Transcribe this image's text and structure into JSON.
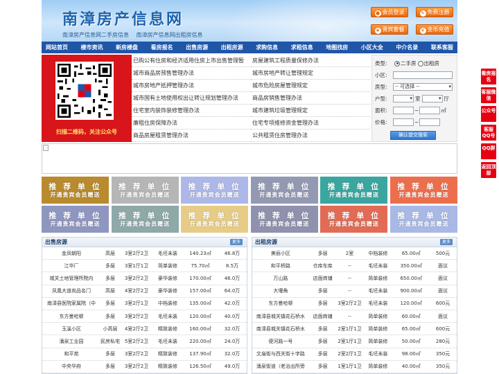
{
  "header": {
    "site_title": "南漳房产信息网",
    "sub_links": [
      "南漳房产信息网二手房信息",
      "南漳房产信息网出租房信息"
    ],
    "buttons": [
      {
        "label": "会员登录",
        "icon": "user-icon"
      },
      {
        "label": "免费注册",
        "icon": "edit-icon"
      },
      {
        "label": "贵宾套餐",
        "icon": "vip-icon"
      },
      {
        "label": "金币充值",
        "icon": "coin-icon"
      }
    ]
  },
  "nav": [
    "网站首页",
    "楼市资讯",
    "新房楼盘",
    "看房报名",
    "出售房源",
    "出租房源",
    "求购信息",
    "求租信息",
    "地图找房",
    "小区大全",
    "中介名录",
    "联系客服"
  ],
  "qr": {
    "caption": "扫描二维码，关注公众号"
  },
  "policy_links": {
    "left": [
      "已购公有住房和经济适用住房上市出售管理暂",
      "城市商品房预售管理办法",
      "城市房地产抵押管理办法",
      "城市国有土地使用权出让转让规划管理办法",
      "住宅室内装饰装修管理办法",
      "廉租住房保障办法",
      "商品房屋租赁管理办法"
    ],
    "right": [
      "房屋建筑工程质量保修办法",
      "城市房地产转让管理规定",
      "城市危险房屋管理规定",
      "商品房销售管理办法",
      "城市建筑垃圾管理规定",
      "住宅专项维修资金管理办法",
      "公共租赁住房管理办法"
    ]
  },
  "search": {
    "type_label": "类型:",
    "type_options": [
      "二手房",
      "出租房"
    ],
    "type_selected": "二手房",
    "community_label": "小区:",
    "community_value": "",
    "layout_label": "房型:",
    "layout_select": "-- 可选择 --",
    "rooms_label": "户型:",
    "room_unit": "室",
    "hall_unit": "厅",
    "area_label": "面积:",
    "area_unit": "㎡",
    "price_label": "价格:",
    "range_sep": "~",
    "submit": "确认提交搜索"
  },
  "ads": {
    "line1": "推 荐 单 位",
    "line2": "开通贵宾会员赠送",
    "colors": [
      "#b98a2e",
      "#b6b6b6",
      "#aeb8e8",
      "#9499b3",
      "#3aa69f",
      "#ec6f4d",
      "#8f96c0",
      "#8fa8a8",
      "#e6cc86",
      "#8f91ad",
      "#e26b55",
      "#a8b9e6"
    ]
  },
  "sale": {
    "title": "出售房源",
    "more": "更多",
    "rows": [
      [
        "金凤朝阳",
        "高层",
        "3室2厅2卫",
        "毛坯未装",
        "140.23㎡",
        "46.8万"
      ],
      [
        "江华厂",
        "多层",
        "3室1厅1卫",
        "简单装修",
        "75.70㎡",
        "8.5万"
      ],
      [
        "城关土地管理所院内",
        "多层",
        "3室2厅2卫",
        "豪华装修",
        "170.00㎡",
        "46.0万"
      ],
      [
        "凤凰大道尚品名门",
        "高层",
        "4室2厅2卫",
        "豪华装修",
        "157.00㎡",
        "64.0万"
      ],
      [
        "南漳县医院家属院（中",
        "多层",
        "3室2厅1卫",
        "中档装修",
        "135.00㎡",
        "42.0万"
      ],
      [
        "东方曼哈顿",
        "多层",
        "3室2厅2卫",
        "毛坯未装",
        "120.00㎡",
        "40.0万"
      ],
      [
        "玉溪小区",
        "小高层",
        "4室2厅2卫",
        "精致装修",
        "160.00㎡",
        "32.0万"
      ],
      [
        "涌泉工业园",
        "民房私宅",
        "5室2厅2卫",
        "毛坯未装",
        "220.00㎡",
        "24.0万"
      ],
      [
        "和平苑",
        "多层",
        "3室2厅2卫",
        "精致装修",
        "137.90㎡",
        "32.0万"
      ],
      [
        "中央华府",
        "多层",
        "3室2厅2卫",
        "精致装修",
        "126.50㎡",
        "49.0万"
      ]
    ]
  },
  "rent": {
    "title": "出租房源",
    "more": "更多",
    "rows": [
      [
        "美丽小区",
        "多层",
        "2室",
        "中档装修",
        "65.00㎡",
        "500元"
      ],
      [
        "和平桥路",
        "仓库车库",
        "--",
        "毛坯未装",
        "350.00㎡",
        "面议"
      ],
      [
        "万山路",
        "店面商铺",
        "--",
        "简单装修",
        "650.00㎡",
        "面议"
      ],
      [
        "大堰角",
        "多层",
        "--",
        "毛坯未装",
        "900.00㎡",
        "面议"
      ],
      [
        "东方曼哈顿",
        "多层",
        "3室2厅2卫",
        "毛坯未装",
        "120.00㎡",
        "600元"
      ],
      [
        "南漳县城关镇花石桥水",
        "店面商铺",
        "--",
        "简单装修",
        "60.00㎡",
        "面议"
      ],
      [
        "南漳县城关镇花石桥水",
        "多层",
        "2室1厅1卫",
        "简单装修",
        "65.00㎡",
        "600元"
      ],
      [
        "便河路一号",
        "多层",
        "2室1厅1卫",
        "简单装修",
        "50.00㎡",
        "280元"
      ],
      [
        "文庙街与西关街十字路",
        "多层",
        "2室2厅1卫",
        "毛坯未装",
        "98.00㎡",
        "350元"
      ],
      [
        "涌泉街道（老治出所旁",
        "多层",
        "1室1厅1卫",
        "简单装修",
        "40.00㎡",
        "350元"
      ]
    ]
  },
  "side_buttons": [
    "看房报名",
    "客服微信",
    "公众号",
    "客服QQ号",
    "QQ群",
    "返回顶部"
  ]
}
